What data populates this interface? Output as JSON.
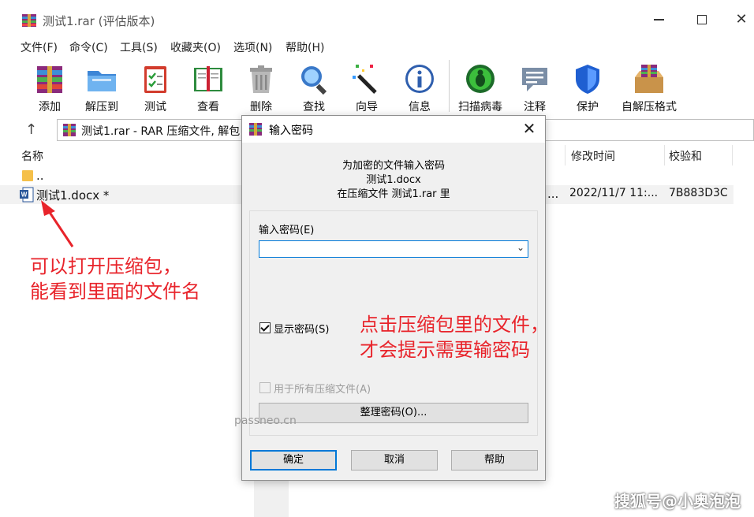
{
  "window": {
    "title": "测试1.rar (评估版本)"
  },
  "menu": [
    "文件(F)",
    "命令(C)",
    "工具(S)",
    "收藏夹(O)",
    "选项(N)",
    "帮助(H)"
  ],
  "toolbar": {
    "add": "添加",
    "extract": "解压到",
    "test": "测试",
    "view": "查看",
    "delete": "删除",
    "find": "查找",
    "wizard": "向导",
    "info": "信息",
    "scan": "扫描病毒",
    "comment": "注释",
    "protect": "保护",
    "sfx": "自解压格式"
  },
  "address": {
    "text": "测试1.rar - RAR 压缩文件, 解包"
  },
  "columns": {
    "name": "名称",
    "modified": "修改时间",
    "checksum": "校验和"
  },
  "files": [
    {
      "name": "..",
      "hidden_mid": "",
      "modified": "",
      "checksum": ""
    },
    {
      "name": "测试1.docx *",
      "hidden_mid": "...",
      "modified": "2022/11/7 11:...",
      "checksum": "7B883D3C"
    }
  ],
  "annotations": {
    "left_line1": "可以打开压缩包，",
    "left_line2": "能看到里面的文件名",
    "right_line1": "点击压缩包里的文件，",
    "right_line2": "才会提示需要输密码"
  },
  "watermark": "passneo.cn",
  "brand": "搜狐号@小奥泡泡",
  "dialog": {
    "title": "输入密码",
    "msg1": "为加密的文件输入密码",
    "msg2": "测试1.docx",
    "msg3": "在压缩文件 测试1.rar 里",
    "pwd_label": "输入密码",
    "pwd_key": "(E)",
    "pwd_value": "",
    "show_pwd_label": "显示密码",
    "show_pwd_key": "(S)",
    "show_pwd_checked": true,
    "all_archives_label": "用于所有压缩文件",
    "all_archives_key": "(A)",
    "organize": "整理密码(O)...",
    "ok": "确定",
    "cancel": "取消",
    "help": "帮助"
  },
  "colors": {
    "annotation": "#e8242b",
    "focus_blue": "#0078d7"
  }
}
